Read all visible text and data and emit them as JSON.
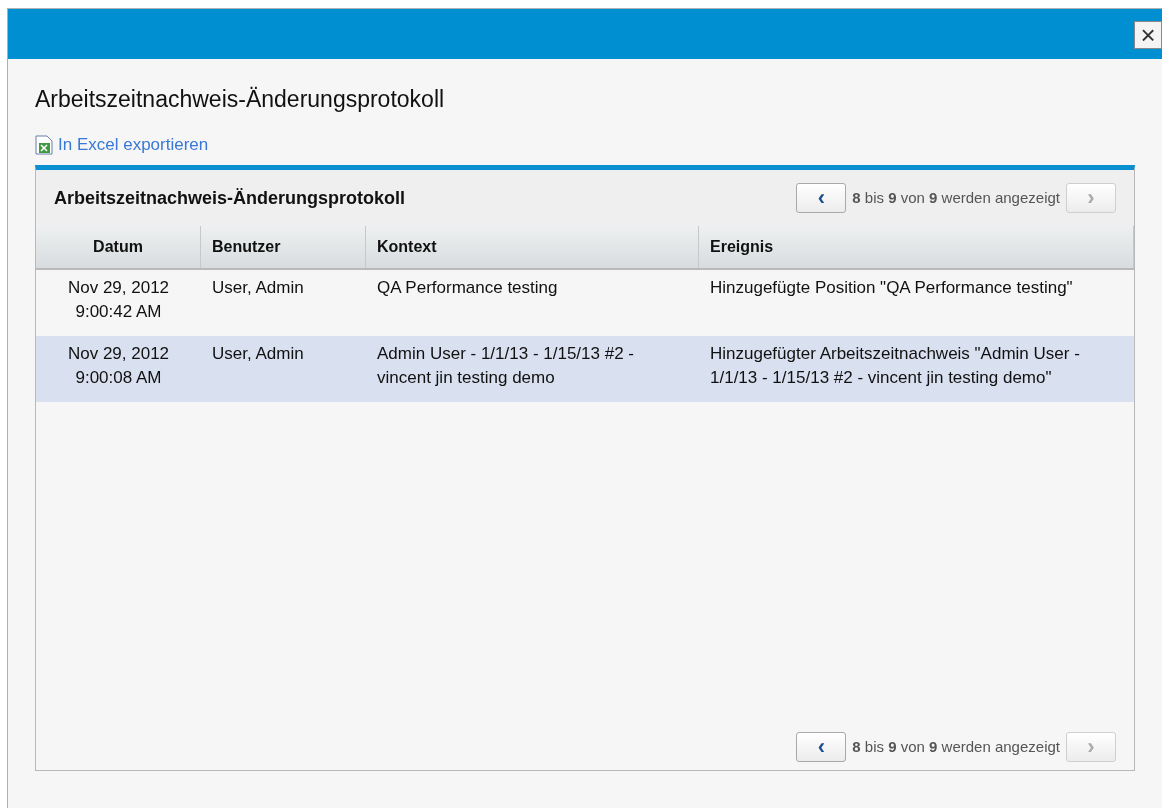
{
  "dialog": {
    "close": "×",
    "title": "Arbeitszeitnachweis-Änderungsprotokoll",
    "export_link": "In Excel exportieren"
  },
  "panel": {
    "title": "Arbeitszeitnachweis-Änderungsprotokoll",
    "pager_top": {
      "prev": "‹",
      "prev_disabled": false,
      "summary": "**8** bis **9** von **9** werden angezeigt",
      "next": "›",
      "next_disabled": true
    },
    "table": {
      "columns": [
        "Datum",
        "Benutzer",
        "Kontext",
        "Ereignis"
      ],
      "rows": [
        {
          "selected": false,
          "cells": [
            "Nov 29, 2012\n9:00:42 AM",
            "User, Admin",
            "QA Performance testing",
            "Hinzugefügte Position \"QA Performance testing\""
          ]
        },
        {
          "selected": true,
          "cells": [
            "Nov 29, 2012\n9:00:08 AM",
            "User, Admin",
            "Admin User - 1/1/13 - 1/15/13 #2 - vincent jin testing demo",
            "Hinzugefügter Arbeitszeitnachweis \"Admin User - 1/1/13 - 1/15/13 #2 - vincent jin testing demo\""
          ]
        }
      ]
    },
    "pager_bottom": {
      "prev": "‹",
      "prev_disabled": false,
      "summary": "**8** bis **9** von **9** werden angezeigt",
      "next": "›",
      "next_disabled": true
    }
  }
}
